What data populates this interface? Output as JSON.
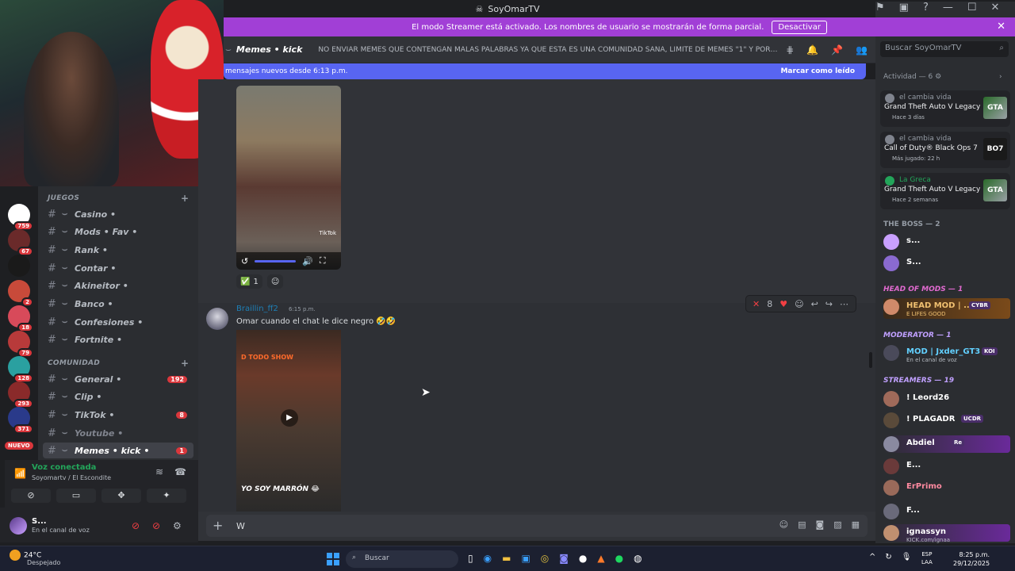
{
  "titlebar": {
    "title": "SoyOmarTV"
  },
  "streamer": {
    "message": "El modo Streamer está activado. Los nombres de usuario se mostrarán de forma parcial.",
    "button": "Desactivar"
  },
  "header": {
    "channel": "Memes • kick",
    "topic": "NO ENVIAR MEMES QUE CONTENGAN MALAS PALABRAS YA QUE ESTA ES UNA COMUNIDAD SANA, LIMITE DE MEMES \"1\" Y POR ULTIMO E...",
    "search_placeholder": "Buscar SoyOmarTV"
  },
  "newbar": {
    "text": "mensajes nuevos desde 6:13 p.m.",
    "mark": "Marcar como leído"
  },
  "servers": [
    {
      "badge": "759"
    },
    {
      "badge": "67"
    },
    {
      "badge": ""
    },
    {
      "badge": "2"
    },
    {
      "badge": "18"
    },
    {
      "badge": "79"
    },
    {
      "badge": "128"
    },
    {
      "badge": "293"
    },
    {
      "badge": "371"
    }
  ],
  "server_new": "NUEVO",
  "categories": {
    "juegos": "JUEGOS",
    "comunidad": "COMUNIDAD"
  },
  "channels": [
    {
      "name": "Casino •",
      "count": ""
    },
    {
      "name": "Mods • Fav •",
      "count": ""
    },
    {
      "name": "Rank •",
      "count": ""
    },
    {
      "name": "Contar •",
      "count": ""
    },
    {
      "name": "Akineitor •",
      "count": ""
    },
    {
      "name": "Banco •",
      "count": ""
    },
    {
      "name": "Confesiones •",
      "count": ""
    },
    {
      "name": "Fortnite •",
      "count": ""
    },
    {
      "name": "General •",
      "count": "192"
    },
    {
      "name": "Clip •",
      "count": ""
    },
    {
      "name": "TikTok •",
      "count": "8"
    },
    {
      "name": "Youtube •",
      "count": ""
    },
    {
      "name": "Memes • kick •",
      "count": "1"
    }
  ],
  "voice": {
    "status": "Voz conectada",
    "channel": "Soyomartv / El Escondite"
  },
  "user": {
    "name": "S...",
    "status": "En el canal de voz"
  },
  "messages": {
    "reaction_count": "1",
    "media1_watermark": "TikTok",
    "author": "Braillin_ff2",
    "time": "6:15 p.m.",
    "text": "Omar cuando el chat le dice negro 🤣🤣",
    "media2_caption": "YO SOY MARRÓN 😂",
    "media2_logo": "D TODO SHOW",
    "action_count": "8"
  },
  "composer": {
    "value": "W"
  },
  "activity": {
    "header": "Actividad — 6",
    "cards": [
      {
        "who": "el cambia vida",
        "game": "Grand Theft Auto V Legacy",
        "meta": "Hace 3 días",
        "art": "GTA",
        "online": false
      },
      {
        "who": "el cambia vida",
        "game": "Call of Duty® Black Ops 7",
        "meta": "Más jugado: 22 h",
        "art": "BO7",
        "online": false
      },
      {
        "who": "La Greca",
        "game": "Grand Theft Auto V Legacy",
        "meta": "Hace 2 semanas",
        "art": "GTA",
        "online": true
      }
    ]
  },
  "members": {
    "boss_header": "THE BOSS — 2",
    "boss": [
      {
        "name": "s..."
      },
      {
        "name": "S..."
      }
    ],
    "mods_header": "HEAD OF MODS — 1",
    "head_mod": {
      "name": "HEAD MOD | ...",
      "tag": "CYBR",
      "sub": "E LIFES GOOD"
    },
    "moderator_header": "MODERATOR — 1",
    "moderator": {
      "name": "MOD | Jxder_GT3",
      "tag": "KOI",
      "sub": "En el canal de voz"
    },
    "streamers_header": "STREAMERS — 19",
    "streamers": [
      {
        "name": "! Leord26",
        "tag": "",
        "sub": ""
      },
      {
        "name": "! PLAGADR",
        "tag": "UCDR",
        "sub": ""
      },
      {
        "name": "Abdiel",
        "tag": "Re",
        "sub": ""
      },
      {
        "name": "E...",
        "tag": "",
        "sub": ""
      },
      {
        "name": "ErPrimo",
        "tag": "",
        "sub": ""
      },
      {
        "name": "F...",
        "tag": "",
        "sub": ""
      },
      {
        "name": "ignassyn",
        "tag": "",
        "sub": "KICK.com/ignaa"
      }
    ]
  },
  "taskbar": {
    "temp": "24°C",
    "condition": "Despejado",
    "search": "Buscar",
    "lang1": "ESP",
    "lang2": "LAA",
    "time": "8:25 p.m.",
    "date": "29/12/2025"
  }
}
